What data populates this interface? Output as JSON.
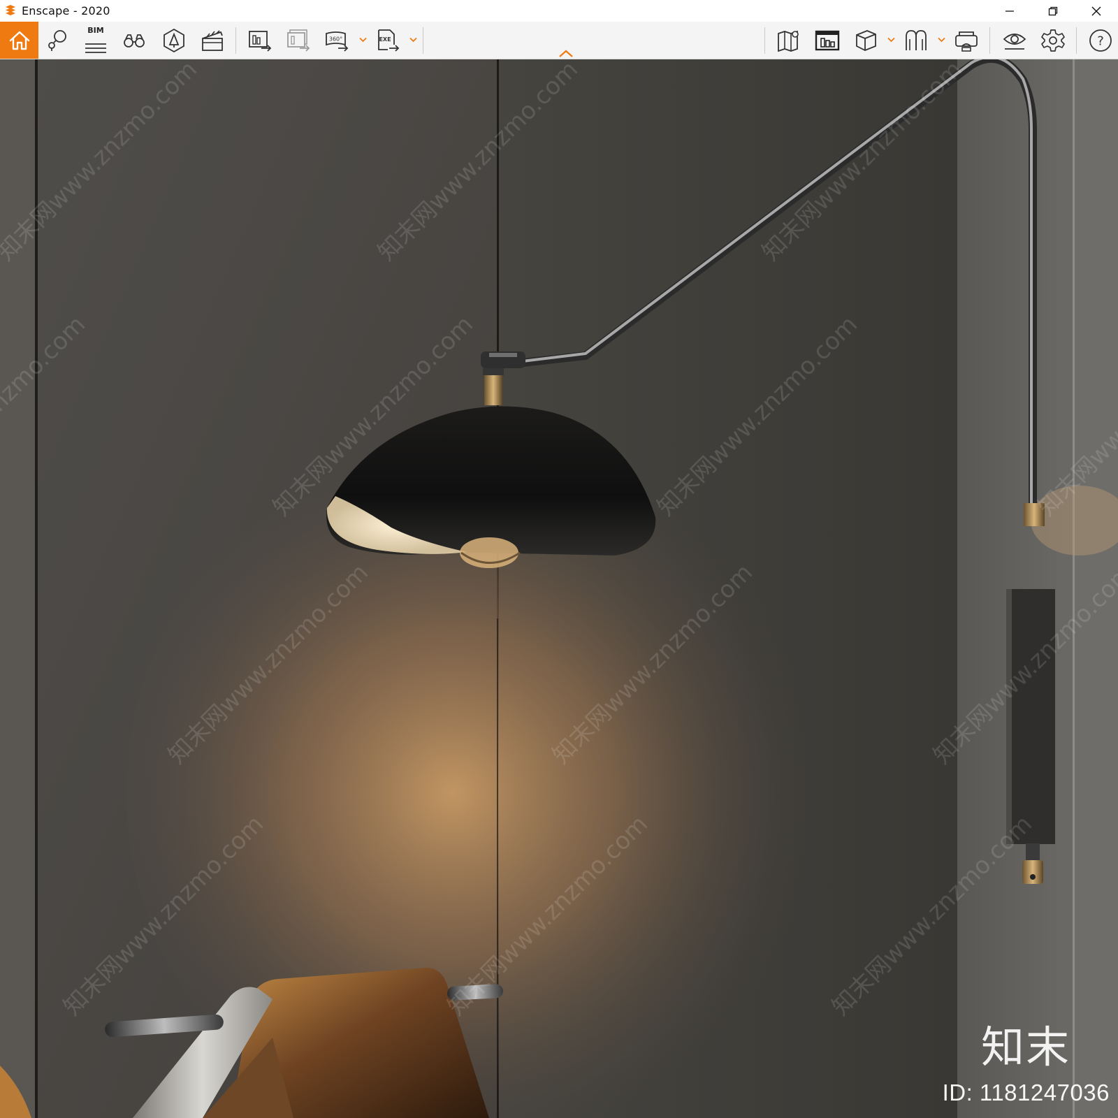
{
  "window": {
    "title": "Enscape - 2020",
    "accent_color": "#f07a12"
  },
  "toolbar": {
    "left_items": [
      {
        "name": "home-icon"
      },
      {
        "name": "views-icon"
      },
      {
        "name": "bim-icon",
        "label": "BIM"
      },
      {
        "name": "binoculars-icon"
      },
      {
        "name": "asset-library-icon"
      },
      {
        "name": "video-editor-icon"
      },
      {
        "name": "screenshot-icon"
      },
      {
        "name": "batch-render-icon"
      },
      {
        "name": "panorama-360-icon",
        "label": "360°"
      },
      {
        "name": "export-exe-icon",
        "label": "EXE"
      }
    ],
    "right_items": [
      {
        "name": "map-icon"
      },
      {
        "name": "render-window-icon"
      },
      {
        "name": "cube-icon"
      },
      {
        "name": "collaborative-annotations-icon"
      },
      {
        "name": "vr-headset-icon"
      },
      {
        "name": "visual-settings-icon"
      },
      {
        "name": "gear-icon"
      },
      {
        "name": "help-icon",
        "label": "?"
      }
    ],
    "collapse_icon": "chevron-up-icon"
  },
  "viewport": {
    "watermark_text": "知末网www.znzmo.com",
    "brand_mark": "知末",
    "brand_id": "ID: 1181247036"
  }
}
